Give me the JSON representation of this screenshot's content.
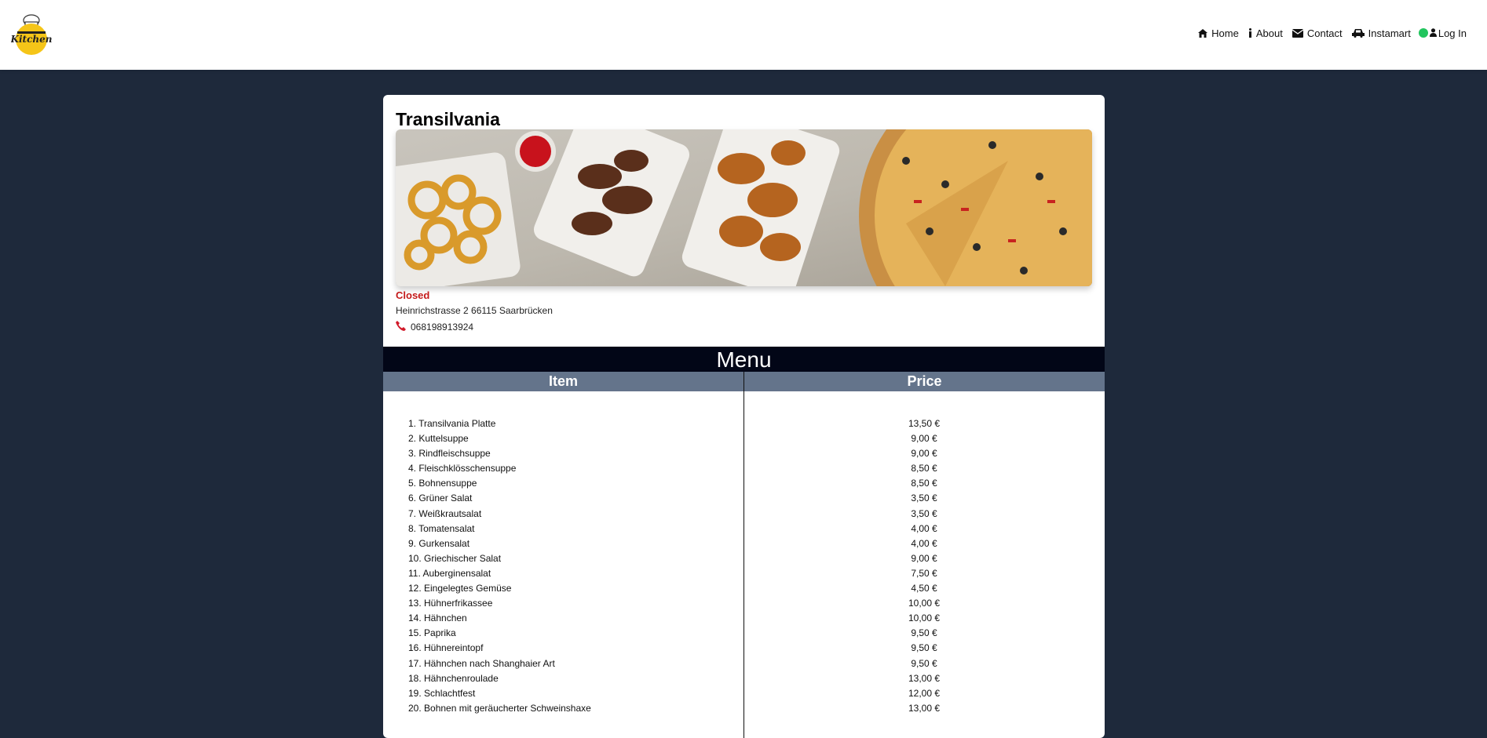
{
  "nav": {
    "links": [
      {
        "label": "Home",
        "icon": "home-icon"
      },
      {
        "label": "About",
        "icon": "info-icon"
      },
      {
        "label": "Contact",
        "icon": "envelope-icon"
      },
      {
        "label": "Instamart",
        "icon": "car-icon"
      }
    ],
    "status_color": "#22c55e",
    "login_label": "Log In"
  },
  "restaurant": {
    "name": "Transilvania",
    "status": "Closed",
    "address": "Heinrichstrasse 2 66115 Saarbrücken",
    "phone": "068198913924"
  },
  "menu": {
    "title": "Menu",
    "columns": {
      "item": "Item",
      "price": "Price"
    },
    "items": [
      {
        "name": "1. Transilvania Platte",
        "price": "13,50 €"
      },
      {
        "name": "2. Kuttelsuppe",
        "price": "9,00 €"
      },
      {
        "name": "3. Rindfleischsuppe",
        "price": "9,00 €"
      },
      {
        "name": "4. Fleischklösschensuppe",
        "price": "8,50 €"
      },
      {
        "name": "5. Bohnensuppe",
        "price": "8,50 €"
      },
      {
        "name": "6. Grüner Salat",
        "price": "3,50 €"
      },
      {
        "name": "7. Weißkrautsalat",
        "price": "3,50 €"
      },
      {
        "name": "8. Tomatensalat",
        "price": "4,00 €"
      },
      {
        "name": "9. Gurkensalat",
        "price": "4,00 €"
      },
      {
        "name": "10. Griechischer Salat",
        "price": "9,00 €"
      },
      {
        "name": "11. Auberginensalat",
        "price": "7,50 €"
      },
      {
        "name": "12. Eingelegtes Gemüse",
        "price": "4,50 €"
      },
      {
        "name": "13. Hühnerfrikassee",
        "price": "10,00 €"
      },
      {
        "name": "14. Hähnchen",
        "price": "10,00 €"
      },
      {
        "name": "15. Paprika",
        "price": "9,50 €"
      },
      {
        "name": "16. Hühnereintopf",
        "price": "9,50 €"
      },
      {
        "name": "17. Hähnchen nach Shanghaier Art",
        "price": "9,50 €"
      },
      {
        "name": "18. Hähnchenroulade",
        "price": "13,00 €"
      },
      {
        "name": "19. Schlachtfest",
        "price": "12,00 €"
      },
      {
        "name": "20. Bohnen mit geräucherter Schweinshaxe",
        "price": "13,00 €"
      }
    ]
  }
}
